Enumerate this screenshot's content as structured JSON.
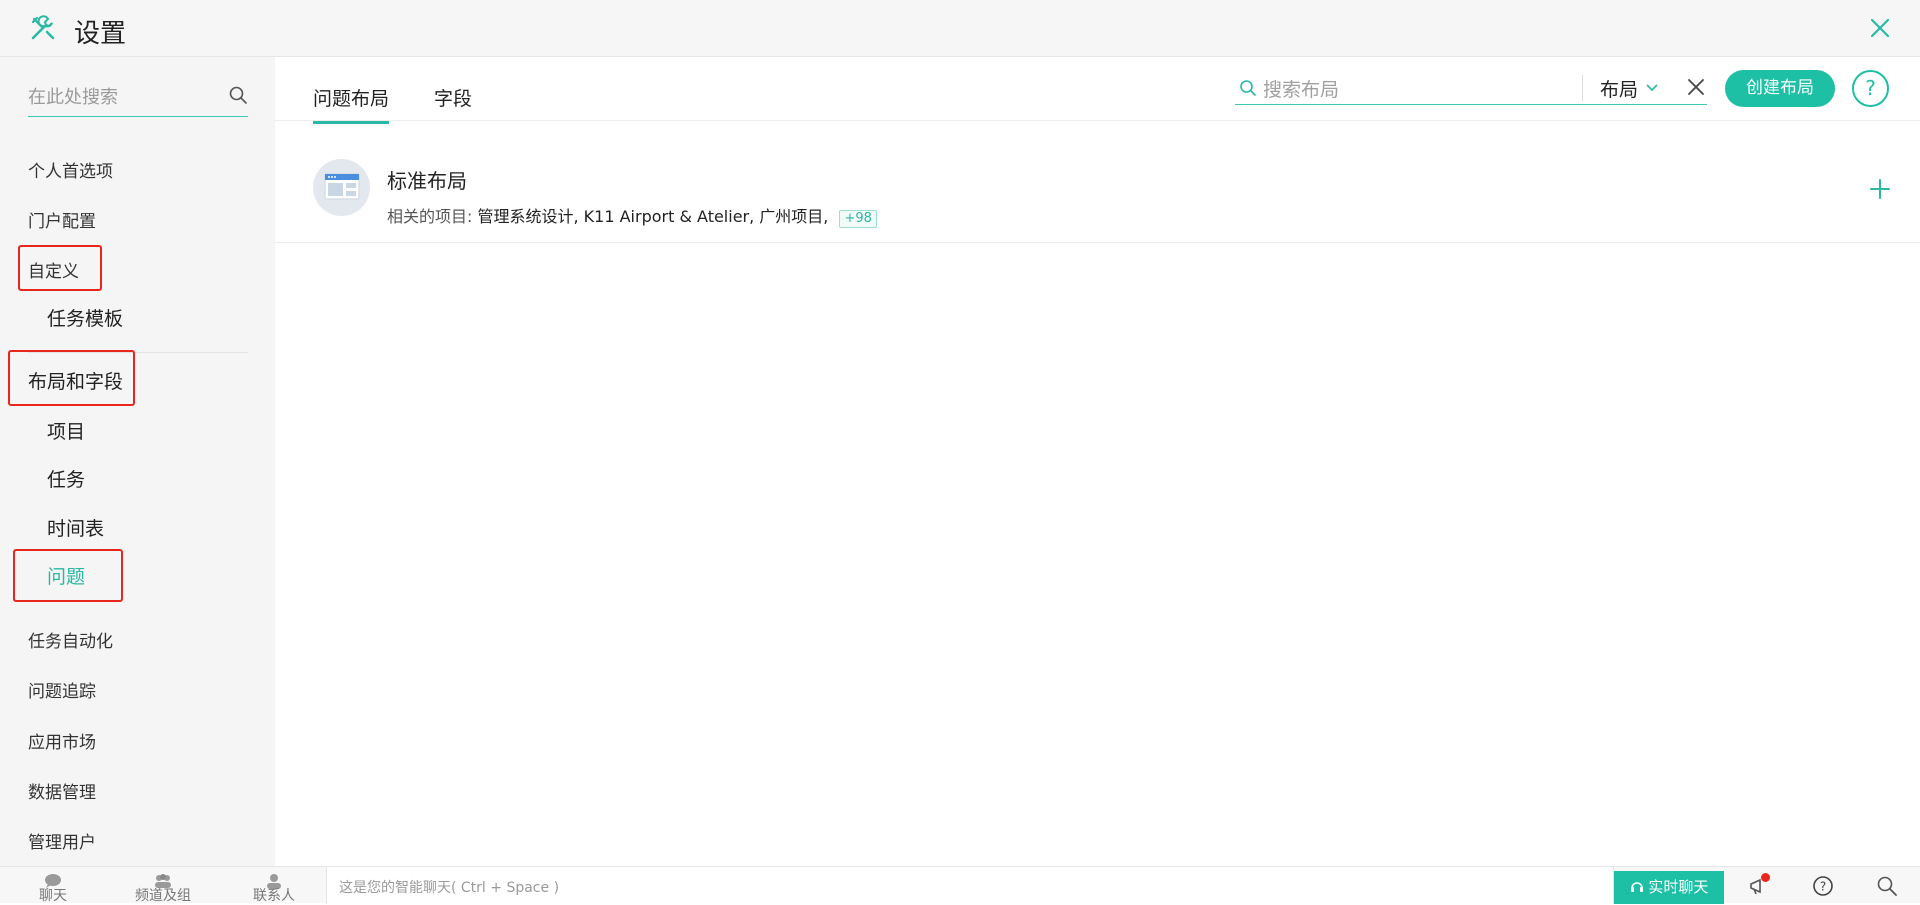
{
  "header": {
    "title": "设置",
    "icon": "tools-icon",
    "close_icon": "close-icon"
  },
  "sidebar": {
    "search_placeholder": "在此处搜索",
    "items": [
      {
        "label": "个人首选项"
      },
      {
        "label": "门户配置"
      },
      {
        "label": "自定义"
      },
      {
        "label": "任务模板"
      },
      {
        "label": "布局和字段"
      },
      {
        "label": "项目"
      },
      {
        "label": "任务"
      },
      {
        "label": "时间表"
      },
      {
        "label": "问题",
        "active": true
      },
      {
        "label": "任务自动化"
      },
      {
        "label": "问题追踪"
      },
      {
        "label": "应用市场"
      },
      {
        "label": "数据管理"
      },
      {
        "label": "管理用户"
      }
    ]
  },
  "main": {
    "tabs": [
      {
        "label": "问题布局",
        "active": true
      },
      {
        "label": "字段"
      }
    ],
    "search_placeholder": "搜索布局",
    "filter_label": "布局",
    "create_button": "创建布局",
    "help_label": "?",
    "layouts": [
      {
        "name": "标准布局",
        "related_label": "相关的项目:",
        "projects": "管理系统设计, K11 Airport & Atelier, 广州项目,",
        "more": "+98"
      }
    ]
  },
  "bottombar": {
    "chat": "聊天",
    "channels": "频道及组",
    "contacts": "联系人",
    "chat_placeholder": "这是您的智能聊天( Ctrl + Space )",
    "live_chat": "实时聊天"
  },
  "colors": {
    "accent": "#1ec0a5",
    "highlight": "#e8261e"
  }
}
